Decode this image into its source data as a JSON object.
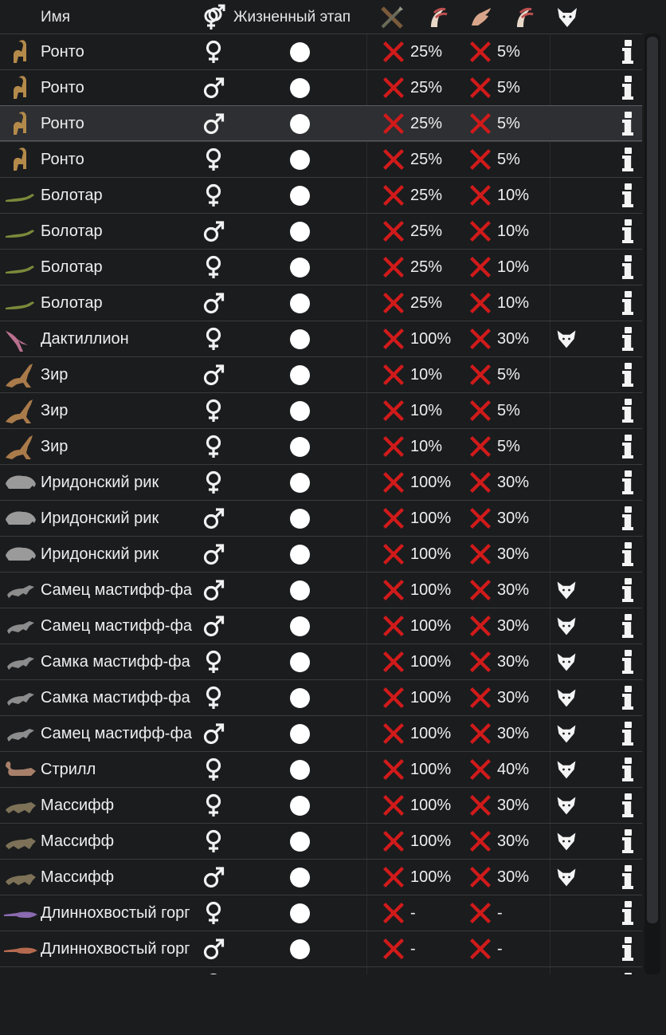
{
  "header": {
    "name_label": "Имя",
    "life_stage_label": "Жизненный этап",
    "columns_icons": [
      "gender-icon",
      "hunt-icon",
      "tame-claw-icon",
      "hand-icon",
      "claw-icon",
      "predator-wolf-icon"
    ]
  },
  "colors": {
    "background": "#1b1c1e",
    "row_border": "#3a3b3d",
    "selected_row": "#2d2f33",
    "cross_red": "#d11a1a",
    "text": "#efefef"
  },
  "rows": [
    {
      "name": "Ронто",
      "sex": "female",
      "hunt": "25%",
      "tame": "5%",
      "predator": false,
      "icon": "ronto-icon",
      "animal_color": "#b48a4a"
    },
    {
      "name": "Ронто",
      "sex": "male",
      "hunt": "25%",
      "tame": "5%",
      "predator": false,
      "icon": "ronto-icon",
      "animal_color": "#b48a4a"
    },
    {
      "name": "Ронто",
      "sex": "male",
      "hunt": "25%",
      "tame": "5%",
      "predator": false,
      "icon": "ronto-icon",
      "animal_color": "#b48a4a",
      "selected": true
    },
    {
      "name": "Ронто",
      "sex": "female",
      "hunt": "25%",
      "tame": "5%",
      "predator": false,
      "icon": "ronto-icon",
      "animal_color": "#b48a4a"
    },
    {
      "name": "Болотар",
      "sex": "female",
      "hunt": "25%",
      "tame": "10%",
      "predator": false,
      "icon": "bolotar-icon",
      "animal_color": "#7a8a3a"
    },
    {
      "name": "Болотар",
      "sex": "male",
      "hunt": "25%",
      "tame": "10%",
      "predator": false,
      "icon": "bolotar-icon",
      "animal_color": "#7a8a3a"
    },
    {
      "name": "Болотар",
      "sex": "female",
      "hunt": "25%",
      "tame": "10%",
      "predator": false,
      "icon": "bolotar-icon",
      "animal_color": "#7a8a3a"
    },
    {
      "name": "Болотар",
      "sex": "male",
      "hunt": "25%",
      "tame": "10%",
      "predator": false,
      "icon": "bolotar-icon",
      "animal_color": "#7a8a3a"
    },
    {
      "name": "Дактиллион",
      "sex": "female",
      "hunt": "100%",
      "tame": "30%",
      "predator": true,
      "icon": "dactillion-icon",
      "animal_color": "#b9708e"
    },
    {
      "name": "Зир",
      "sex": "male",
      "hunt": "10%",
      "tame": "5%",
      "predator": false,
      "icon": "zir-icon",
      "animal_color": "#a97a4a"
    },
    {
      "name": "Зир",
      "sex": "female",
      "hunt": "10%",
      "tame": "5%",
      "predator": false,
      "icon": "zir-icon",
      "animal_color": "#a97a4a"
    },
    {
      "name": "Зир",
      "sex": "female",
      "hunt": "10%",
      "tame": "5%",
      "predator": false,
      "icon": "zir-icon",
      "animal_color": "#a97a4a"
    },
    {
      "name": "Иридонский рик",
      "sex": "female",
      "hunt": "100%",
      "tame": "30%",
      "predator": false,
      "icon": "iridonian-rik-icon",
      "animal_color": "#9a9a9a"
    },
    {
      "name": "Иридонский рик",
      "sex": "male",
      "hunt": "100%",
      "tame": "30%",
      "predator": false,
      "icon": "iridonian-rik-icon",
      "animal_color": "#9a9a9a"
    },
    {
      "name": "Иридонский рик",
      "sex": "male",
      "hunt": "100%",
      "tame": "30%",
      "predator": false,
      "icon": "iridonian-rik-icon",
      "animal_color": "#9a9a9a"
    },
    {
      "name": "Самец мастифф-фа",
      "sex": "male",
      "hunt": "100%",
      "tame": "30%",
      "predator": true,
      "icon": "mastiff-phalone-icon",
      "animal_color": "#8c8c8c"
    },
    {
      "name": "Самец мастифф-фа",
      "sex": "male",
      "hunt": "100%",
      "tame": "30%",
      "predator": true,
      "icon": "mastiff-phalone-icon",
      "animal_color": "#8c8c8c"
    },
    {
      "name": "Самка мастифф-фа",
      "sex": "female",
      "hunt": "100%",
      "tame": "30%",
      "predator": true,
      "icon": "mastiff-phalone-icon",
      "animal_color": "#8c8c8c"
    },
    {
      "name": "Самка мастифф-фа",
      "sex": "female",
      "hunt": "100%",
      "tame": "30%",
      "predator": true,
      "icon": "mastiff-phalone-icon",
      "animal_color": "#8c8c8c"
    },
    {
      "name": "Самец мастифф-фа",
      "sex": "male",
      "hunt": "100%",
      "tame": "30%",
      "predator": true,
      "icon": "mastiff-phalone-icon",
      "animal_color": "#8c8c8c"
    },
    {
      "name": "Стрилл",
      "sex": "female",
      "hunt": "100%",
      "tame": "40%",
      "predator": true,
      "icon": "strill-icon",
      "animal_color": "#a8806a"
    },
    {
      "name": "Массифф",
      "sex": "female",
      "hunt": "100%",
      "tame": "30%",
      "predator": true,
      "icon": "massiff-icon",
      "animal_color": "#7d7258"
    },
    {
      "name": "Массифф",
      "sex": "female",
      "hunt": "100%",
      "tame": "30%",
      "predator": true,
      "icon": "massiff-icon",
      "animal_color": "#7d7258"
    },
    {
      "name": "Массифф",
      "sex": "male",
      "hunt": "100%",
      "tame": "30%",
      "predator": true,
      "icon": "massiff-icon",
      "animal_color": "#7d7258"
    },
    {
      "name": "Длиннохвостый горг",
      "sex": "female",
      "hunt": "-",
      "tame": "-",
      "predator": false,
      "icon": "longtail-gorg-icon",
      "animal_color": "#8a6ab0"
    },
    {
      "name": "Длиннохвостый горг",
      "sex": "male",
      "hunt": "-",
      "tame": "-",
      "predator": false,
      "icon": "longtail-gorg-icon",
      "animal_color": "#b56a50"
    },
    {
      "name": "",
      "sex": "female",
      "hunt": "",
      "tame": "",
      "predator": false,
      "icon": "partial-row-icon",
      "animal_color": "#555555"
    }
  ]
}
